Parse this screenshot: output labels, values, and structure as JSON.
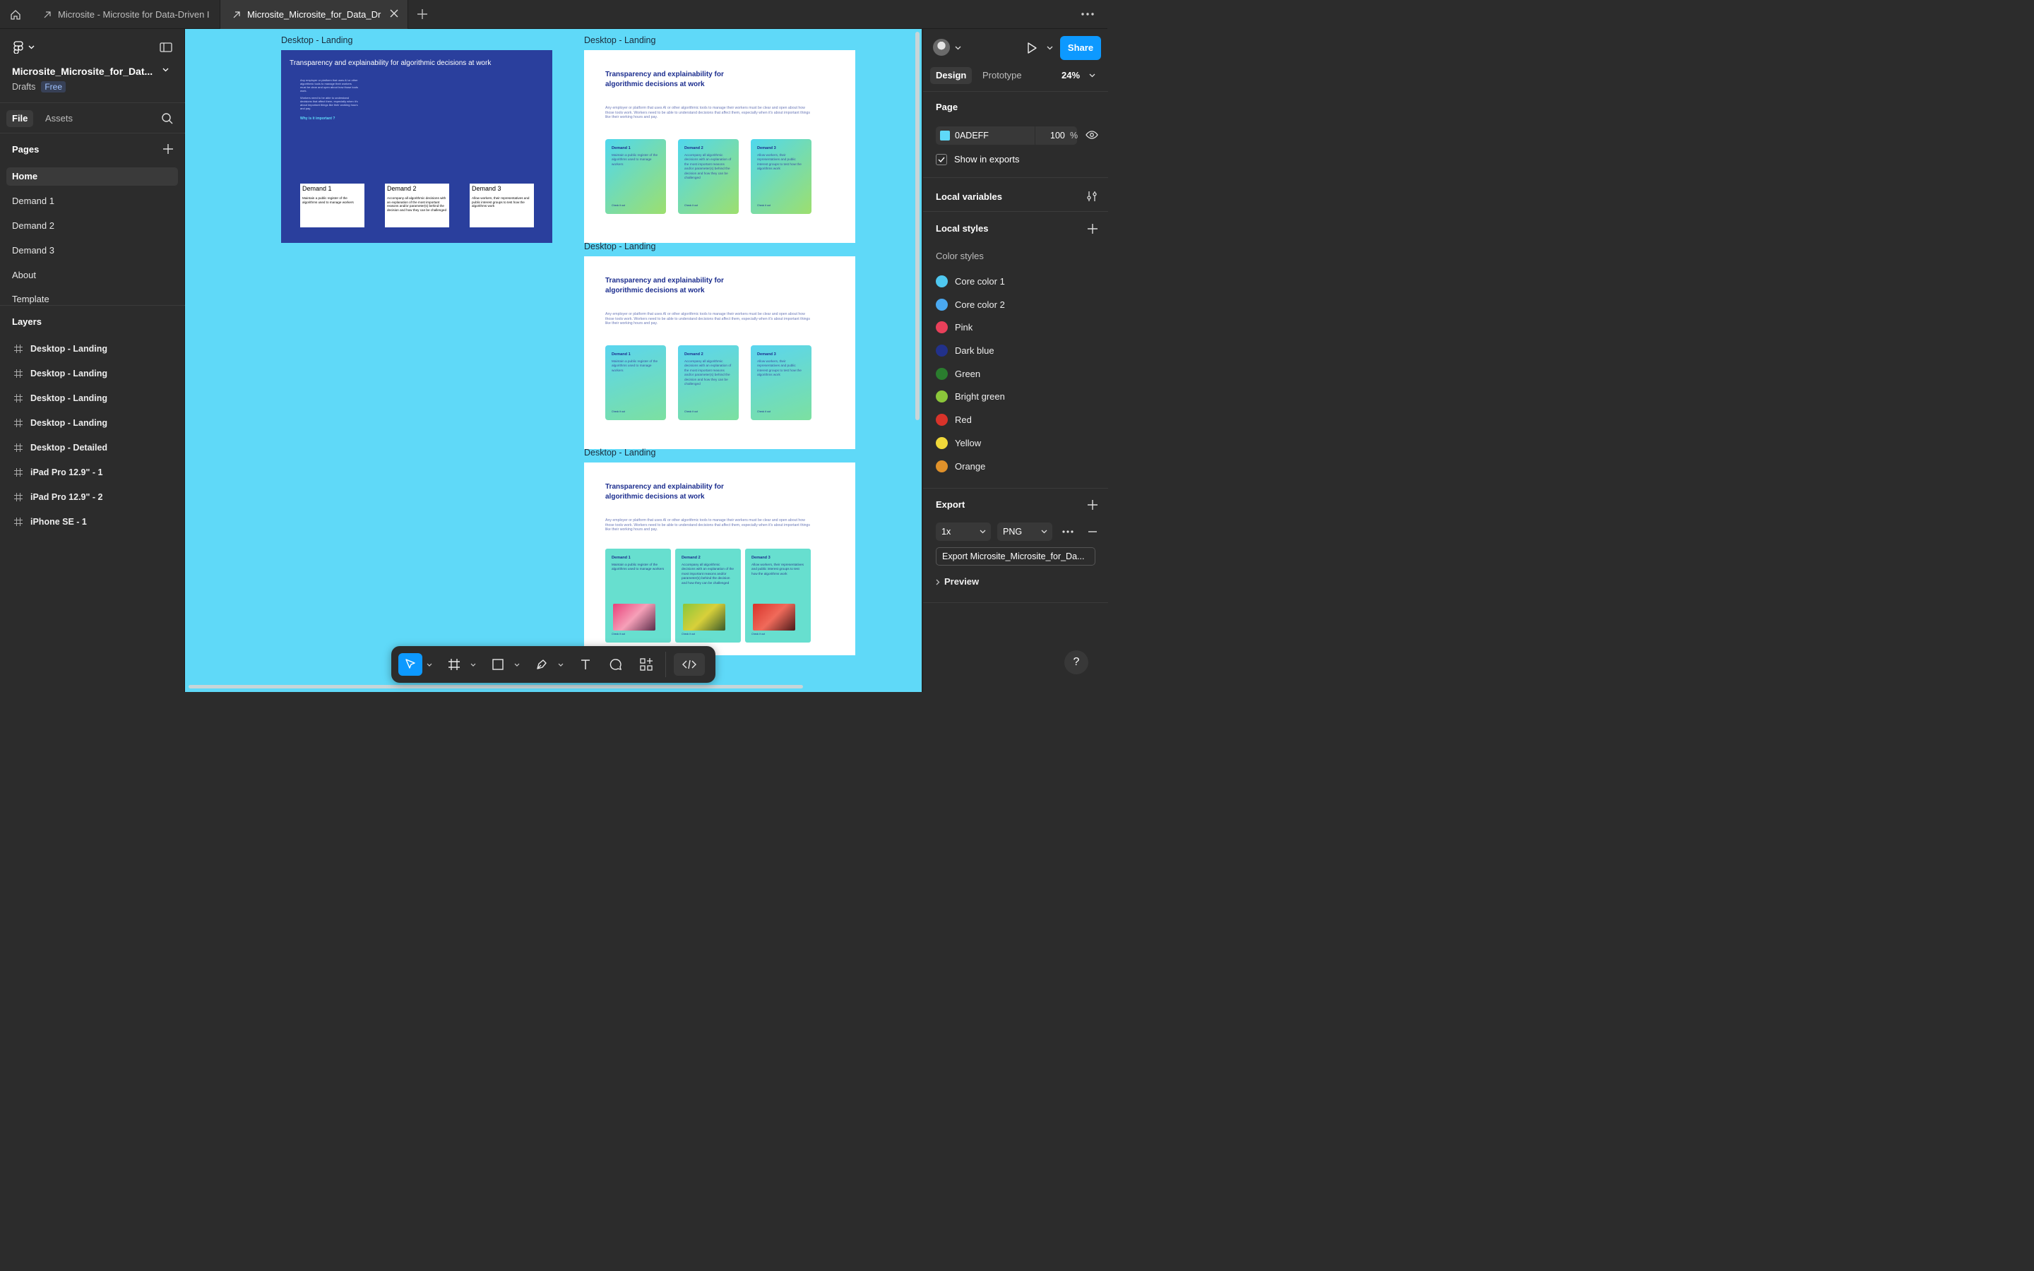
{
  "tabs": [
    {
      "label": "Microsite - Microsite for Data-Driven I"
    },
    {
      "label": "Microsite_Microsite_for_Data_Dri"
    }
  ],
  "file": {
    "title": "Microsite_Microsite_for_Dat...",
    "drafts": "Drafts",
    "plan": "Free"
  },
  "left_tabs": {
    "file": "File",
    "assets": "Assets"
  },
  "pages": {
    "heading": "Pages",
    "items": [
      "Home",
      "Demand 1",
      "Demand 2",
      "Demand 3",
      "About",
      "Template"
    ]
  },
  "layers": {
    "heading": "Layers",
    "items": [
      "Desktop - Landing",
      "Desktop - Landing",
      "Desktop - Landing",
      "Desktop - Landing",
      "Desktop - Detailed",
      "iPad Pro 12.9\" - 1",
      "iPad Pro 12.9\" - 2",
      "iPhone SE - 1"
    ]
  },
  "canvas": {
    "bg_color": "#5fd9f8",
    "frame_label": "Desktop - Landing",
    "landing_title": "Transparency and explainability for algorithmic decisions at work",
    "intro_short": "Any employer or platform that uses AI or other algorithmic tools to manage their workers must be clear and open about how those tools work.",
    "intro_short_2": "Workers need to be able to understand decisions that affect them, especially when it's about important things like their working hours and pay.",
    "why": "Why is it important ?",
    "intro_long": "Any employer or platform that uses AI or other algorithmic tools to manage their workers must be clear and open about how those tools work. Workers need to be able to understand decisions that affect them, especially when it's about important things like their working hours and pay.",
    "check_it_out": "Check it out",
    "demands": [
      {
        "title": "Demand 1",
        "text": "Maintain a public register of the algorithms used to manage workers"
      },
      {
        "title": "Demand 2",
        "text": "Accompany all algorithmic decisions with an explanation of the most important reasons and/or parameter(s) behind the decision and how they can be challenged"
      },
      {
        "title": "Demand 3",
        "text": "Allow workers, their representatives and public interest groups to test how the algorithms work"
      }
    ]
  },
  "right": {
    "share": "Share",
    "tab_design": "Design",
    "tab_prototype": "Prototype",
    "zoom": "24%",
    "page_heading": "Page",
    "page_color": "0ADEFF",
    "page_opacity": "100",
    "pct": "%",
    "show_in_exports": "Show in exports",
    "local_variables": "Local variables",
    "local_styles": "Local styles",
    "color_styles": "Color styles",
    "styles": [
      {
        "name": "Core color 1",
        "color": "#4fc8f0"
      },
      {
        "name": "Core color 2",
        "color": "#4aa8f0"
      },
      {
        "name": "Pink",
        "color": "#e8405a"
      },
      {
        "name": "Dark blue",
        "color": "#22318a"
      },
      {
        "name": "Green",
        "color": "#2a7d2e"
      },
      {
        "name": "Bright green",
        "color": "#8bc63a"
      },
      {
        "name": "Red",
        "color": "#d8332a"
      },
      {
        "name": "Yellow",
        "color": "#f0d83a"
      },
      {
        "name": "Orange",
        "color": "#e0912a"
      }
    ],
    "export_heading": "Export",
    "export_scale": "1x",
    "export_format": "PNG",
    "export_button": "Export Microsite_Microsite_for_Da...",
    "preview": "Preview",
    "help": "?"
  }
}
